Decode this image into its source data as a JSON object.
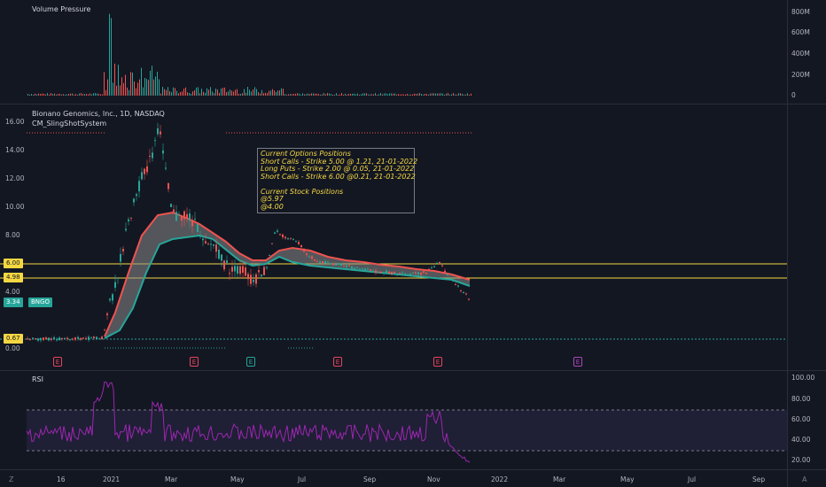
{
  "volume_pane": {
    "title": "Volume Pressure",
    "axis_labels": [
      "800M",
      "600M",
      "400M",
      "200M",
      "0"
    ]
  },
  "price_pane": {
    "symbol_title": "Bionano Genomics, Inc., 1D, NASDAQ",
    "indicator": "CM_SlingShotSystem",
    "axis_labels": [
      "16.00",
      "14.00",
      "12.00",
      "10.00",
      "8.00",
      "6.00",
      "4.98",
      "4.00",
      "3.34",
      "0.67",
      "0.00"
    ],
    "tags": {
      "line_6": "6.00",
      "line_498": "4.98",
      "last_price": "3.34",
      "ticker": "BNGO",
      "level_067": "0.67"
    },
    "annotation": {
      "lines": [
        "Current Options Positions",
        "Short Calls - Strike 5.00 @ 1.21, 21-01-2022",
        "Long Puts - Strike 2.00 @ 0.05, 21-01-2022",
        "Short Calls - Strike 6.00 @0.21, 21-01-2022",
        "",
        "Current Stock Positions",
        "@5.97",
        "@4.00"
      ]
    },
    "earnings_marker": "E"
  },
  "rsi_pane": {
    "title": "RSI",
    "axis_labels": [
      "100.00",
      "80.00",
      "60.00",
      "40.00",
      "20.00"
    ]
  },
  "time_axis": {
    "labels": [
      "16",
      "2021",
      "Mar",
      "May",
      "Jul",
      "Sep",
      "Nov",
      "2022",
      "Mar",
      "May",
      "Jul",
      "Sep"
    ]
  },
  "corner_left": "Z",
  "corner_right": "A",
  "colors": {
    "background": "#131722",
    "up": "#26a69a",
    "down": "#ef5350",
    "line_yellow": "#f5d742",
    "rsi": "#9c27b0"
  },
  "chart_data": {
    "type": "candlestick",
    "series": [
      {
        "name": "Bionano Genomics, Inc., 1D, NASDAQ",
        "x": [
          "2020-11",
          "2020-12",
          "2021-01",
          "2021-02",
          "2021-03",
          "2021-04",
          "2021-05",
          "2021-06",
          "2021-07",
          "2021-08",
          "2021-09",
          "2021-10",
          "2021-11",
          "2021-12"
        ],
        "values": [
          0.6,
          0.8,
          5.0,
          12.0,
          8.5,
          6.5,
          5.0,
          8.5,
          6.0,
          5.5,
          5.0,
          5.0,
          5.4,
          3.34
        ]
      }
    ],
    "horizontal_levels": [
      6.0,
      4.98,
      0.67
    ],
    "rsi_levels": [
      70,
      30
    ]
  }
}
